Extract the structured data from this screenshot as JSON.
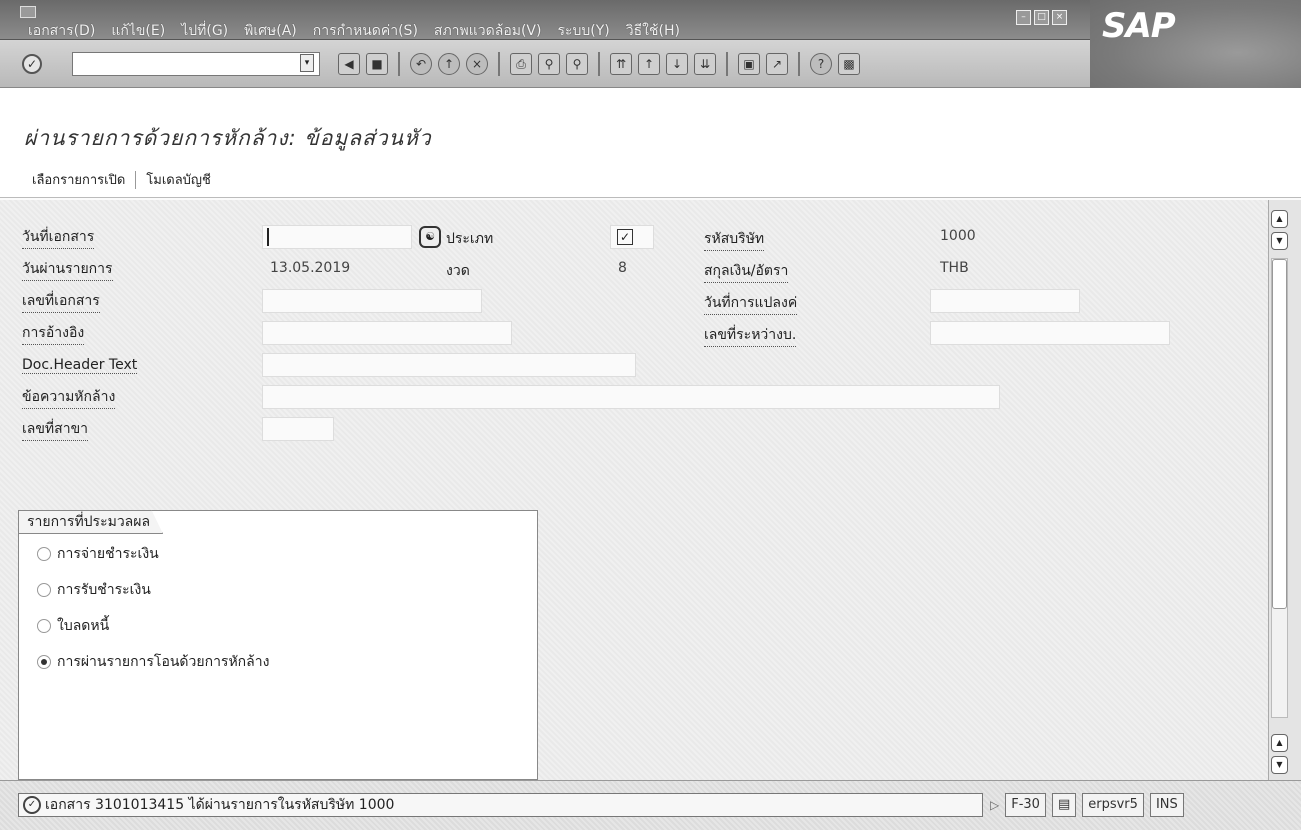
{
  "menubar": {
    "items": [
      "เอกสาร(D)",
      "แก้ไข(E)",
      "ไปที่(G)",
      "พิเศษ(A)",
      "การกำหนดค่า(S)",
      "สภาพแวดล้อม(V)",
      "ระบบ(Y)",
      "วิธีใช้(H)"
    ]
  },
  "logo": {
    "text": "SAP"
  },
  "toolbar": {
    "command_field_value": "",
    "icons": [
      "back-icon",
      "save-icon",
      "exit-icon",
      "cancel-icon",
      "print-icon",
      "find-icon",
      "find-next-icon",
      "first-page-icon",
      "previous-page-icon",
      "next-page-icon",
      "last-page-icon",
      "new-session-icon",
      "shortcut-icon",
      "help-icon",
      "customize-layout-icon"
    ]
  },
  "title": "ผ่านรายการด้วยการหักล้าง: ข้อมูลส่วนหัว",
  "app_toolbar": {
    "select_open_items": "เลือกรายการเปิด",
    "account_model": "โมเดลบัญชี"
  },
  "form": {
    "document_date_label": "วันที่เอกสาร",
    "document_date_value": "",
    "type_label": "ประเภท",
    "company_code_label": "รหัสบริษัท",
    "company_code_value": "1000",
    "posting_date_label": "วันผ่านรายการ",
    "posting_date_value": "13.05.2019",
    "period_label": "งวด",
    "period_value": "8",
    "currency_label": "สกุลเงิน/อัตรา",
    "currency_value": "THB",
    "document_number_label": "เลขที่เอกสาร",
    "translation_date_label": "วันที่การแปลงค่",
    "reference_label": "การอ้างอิง",
    "intercompany_label": "เลขที่ระหว่างบ.",
    "header_text_label": "Doc.Header Text",
    "clearing_text_label": "ข้อความหักล้าง",
    "branch_number_label": "เลขที่สาขา"
  },
  "transactions": {
    "title": "รายการที่ประมวลผล",
    "options": [
      {
        "label": "การจ่ายชำระเงิน",
        "selected": false
      },
      {
        "label": "การรับชำระเงิน",
        "selected": false
      },
      {
        "label": "ใบลดหนี้",
        "selected": false
      },
      {
        "label": "การผ่านรายการโอนด้วยการหักล้าง",
        "selected": true
      }
    ]
  },
  "status": {
    "message": "เอกสาร 3101013415 ได้ผ่านรายการในรหัสบริษัท 1000",
    "transaction": "F-30",
    "server": "erpsvr5",
    "mode": "INS"
  }
}
